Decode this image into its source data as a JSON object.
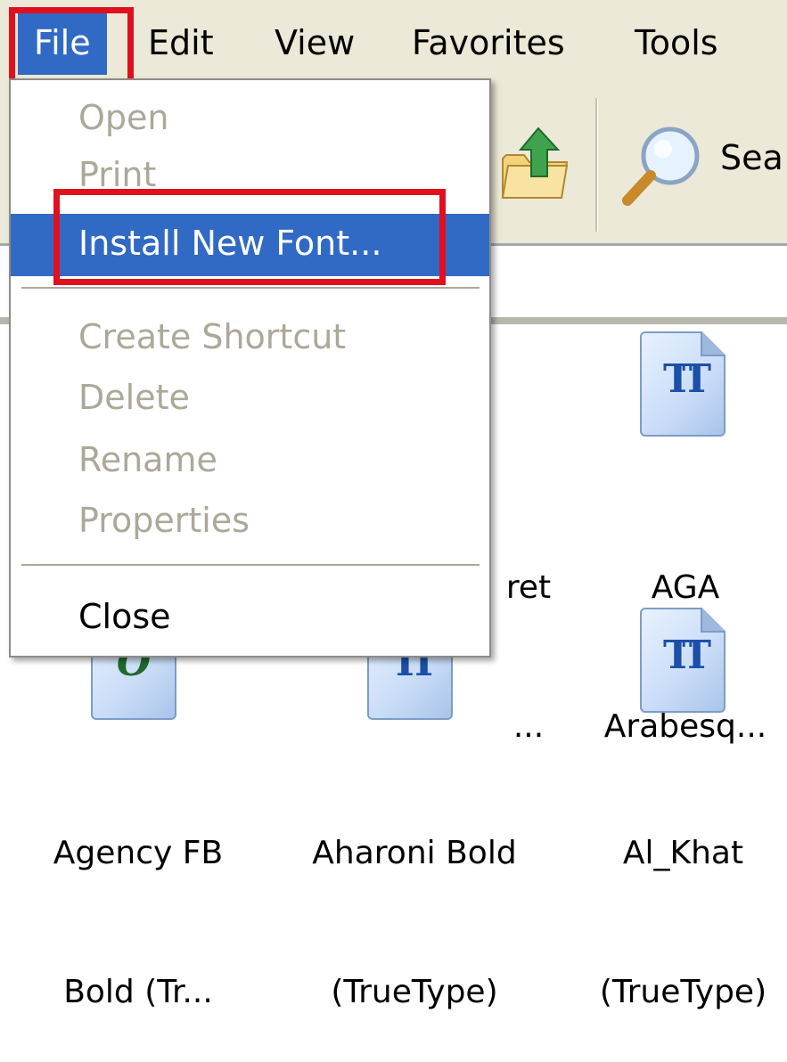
{
  "menubar": {
    "items": [
      "File",
      "Edit",
      "View",
      "Favorites",
      "Tools"
    ]
  },
  "toolbar": {
    "search_label": "Sea"
  },
  "file_menu": {
    "items": [
      {
        "label": "Open",
        "enabled": false
      },
      {
        "label": "Print",
        "enabled": false
      },
      {
        "label": "Install New Font...",
        "enabled": true,
        "selected": true
      },
      {
        "label": "Create Shortcut",
        "enabled": false
      },
      {
        "label": "Delete",
        "enabled": false
      },
      {
        "label": "Rename",
        "enabled": false
      },
      {
        "label": "Properties",
        "enabled": false
      },
      {
        "label": "Close",
        "enabled": true
      }
    ]
  },
  "fonts": [
    {
      "label_line1": "ret",
      "label_line2": "..."
    },
    {
      "label_line1": "AGA",
      "label_line2": "Arabesq..."
    },
    {
      "label_line1": "Agency FB",
      "label_line2": "Bold (Tr..."
    },
    {
      "label_line1": "Aharoni Bold",
      "label_line2": "(TrueType)"
    },
    {
      "label_line1": "Al_Khat",
      "label_line2": "(TrueType)"
    }
  ],
  "icons": {
    "truetype_glyph": "TT",
    "opentype_glyph": "O"
  },
  "colors": {
    "highlight": "#316ac5",
    "annotation_box": "#e0101e",
    "disabled_text": "#aca899",
    "chrome": "#ece9d8"
  }
}
